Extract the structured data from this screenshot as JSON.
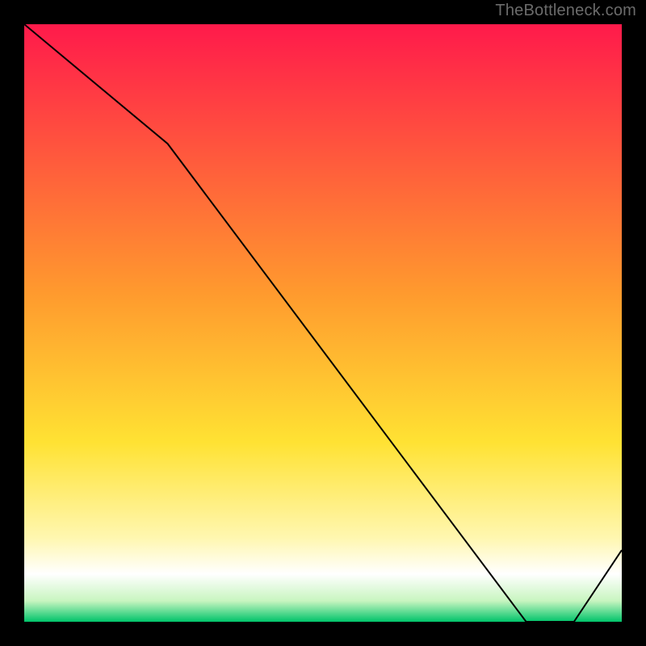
{
  "attribution": "TheBottleneck.com",
  "chart_data": {
    "type": "line",
    "title": "",
    "xlabel": "",
    "ylabel": "",
    "xlim": [
      0,
      100
    ],
    "ylim": [
      0,
      100
    ],
    "x": [
      0,
      24,
      84,
      92,
      100
    ],
    "values": [
      100,
      80,
      0,
      0,
      12
    ],
    "annotation": {
      "label": "",
      "x": 86,
      "y": 1
    },
    "background": {
      "type": "vertical_gradient_with_band",
      "stops": [
        {
          "pos": 0.0,
          "color": "#ff1a4b"
        },
        {
          "pos": 0.45,
          "color": "#ff9a2e"
        },
        {
          "pos": 0.7,
          "color": "#ffe233"
        },
        {
          "pos": 0.86,
          "color": "#fff7b0"
        },
        {
          "pos": 0.92,
          "color": "#ffffff"
        },
        {
          "pos": 0.965,
          "color": "#c8f5c0"
        },
        {
          "pos": 1.0,
          "color": "#00c46a"
        }
      ]
    },
    "line_style": {
      "stroke": "#000000",
      "width": 2
    }
  }
}
